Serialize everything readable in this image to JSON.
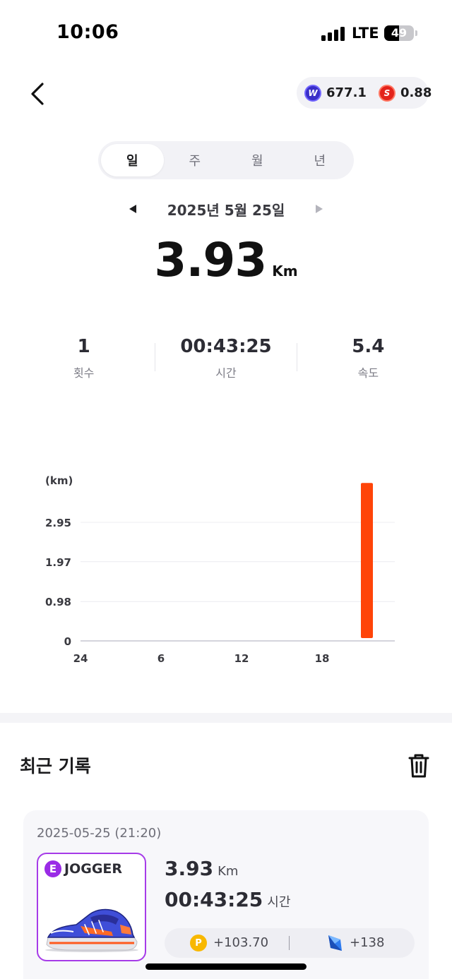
{
  "status_bar": {
    "time": "10:06",
    "network": "LTE",
    "battery_level": "49"
  },
  "header": {
    "back_icon": "chevron-left-icon",
    "wallet": [
      {
        "icon": "w-token-icon",
        "letter": "W",
        "value": "677.1",
        "color": "#3a2fc8"
      },
      {
        "icon": "s-token-icon",
        "letter": "S",
        "value": "0.88",
        "color": "#e3231b"
      }
    ]
  },
  "period_tabs": [
    {
      "label": "일",
      "active": true
    },
    {
      "label": "주",
      "active": false
    },
    {
      "label": "월",
      "active": false
    },
    {
      "label": "년",
      "active": false
    }
  ],
  "date_nav": {
    "label": "2025년 5월 25일",
    "prev_icon": "triangle-left-icon",
    "next_icon": "triangle-right-icon"
  },
  "summary": {
    "distance": "3.93",
    "unit": "Km",
    "stats": [
      {
        "value": "1",
        "label": "횟수"
      },
      {
        "value": "00:43:25",
        "label": "시간"
      },
      {
        "value": "5.4",
        "label": "속도"
      }
    ]
  },
  "chart_data": {
    "type": "bar",
    "ylabel": "(km)",
    "y_ticks": [
      "2.95",
      "1.97",
      "0.98",
      "0"
    ],
    "y_tick_values": [
      2.95,
      1.97,
      0.98,
      0
    ],
    "x_ticks": [
      "24",
      "6",
      "12",
      "18"
    ],
    "x_tick_hours": [
      0,
      6,
      12,
      18
    ],
    "ylim": [
      0,
      3.93
    ],
    "xlim": [
      0,
      23
    ],
    "bars": [
      {
        "hour": 21,
        "value": 3.93
      }
    ],
    "bar_color": "#ff4408",
    "grid": true
  },
  "recent": {
    "title": "최근 기록",
    "trash_icon": "trash-icon",
    "records": [
      {
        "datetime": "2025-05-25 (21:20)",
        "shoe_grade": "E",
        "shoe_name": "JOGGER",
        "distance": "3.93",
        "distance_unit": "Km",
        "duration": "00:43:25",
        "duration_label": "시간",
        "reward_points": "+103.70",
        "reward_gems": "+138",
        "points_icon": "p-coin-icon",
        "gem_icon": "blue-gem-icon"
      }
    ]
  }
}
